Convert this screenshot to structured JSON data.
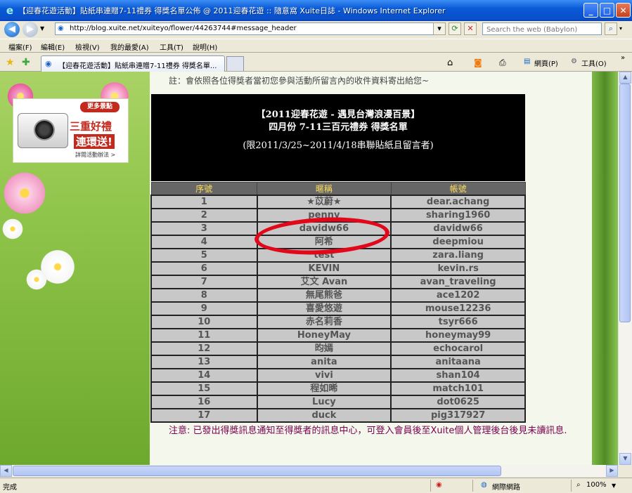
{
  "window": {
    "title": "【迎春花遊活動】貼紙串連贈7-11禮券 得獎名單公佈 @ 2011迎春花遊 :: 隨意窩 Xuite日誌 - Windows Internet Explorer",
    "min": "_",
    "max": "□",
    "close": "✕"
  },
  "address": {
    "url": "http://blog.xuite.net/xuiteyo/flower/44263744#message_header",
    "search_placeholder": "Search the web (Babylon)"
  },
  "menu": [
    "檔案(F)",
    "編輯(E)",
    "檢視(V)",
    "我的最愛(A)",
    "工具(T)",
    "說明(H)"
  ],
  "tab": {
    "label": "【迎春花遊活動】貼紙串連贈7-11禮券 得獎名單..."
  },
  "toolbar": {
    "page": "網頁(P)",
    "tools": "工具(O)",
    "more": "»"
  },
  "promo": {
    "more": "更多景點",
    "line1": "三重好禮",
    "line2": "連環送!",
    "detail": "詳閱活動辦法 >"
  },
  "content": {
    "note_top": "註：會依照各位得獎者當初您參與活動所留言內的收件資料寄出給您~",
    "header_line1": "【2011迎春花遊 - 遇見台灣浪漫百景】",
    "header_line2": "四月份 7-11三百元禮券 得獎名單",
    "header_line3": "(限2011/3/25~2011/4/18串聯貼紙且留言者)",
    "columns": [
      "序號",
      "暱稱",
      "帳號"
    ],
    "rows": [
      [
        "1",
        "★苡蔚★",
        "dear.achang"
      ],
      [
        "2",
        "penny",
        "sharing1960"
      ],
      [
        "3",
        "davidw66",
        "davidw66"
      ],
      [
        "4",
        "阿希",
        "deepmiou"
      ],
      [
        "5",
        "test",
        "zara.liang"
      ],
      [
        "6",
        "KEVIN",
        "kevin.rs"
      ],
      [
        "7",
        "艾文 Avan",
        "avan_traveling"
      ],
      [
        "8",
        "無尾熊爸",
        "ace1202"
      ],
      [
        "9",
        "喜愛悠遊",
        "mouse12236"
      ],
      [
        "10",
        "赤名莉香",
        "tsyr666"
      ],
      [
        "11",
        "HoneyMay",
        "honeymay99"
      ],
      [
        "12",
        "昀嫣",
        "echocarol"
      ],
      [
        "13",
        "anita",
        "anitaana"
      ],
      [
        "14",
        "vivi",
        "shan104"
      ],
      [
        "15",
        "程如晞",
        "match101"
      ],
      [
        "16",
        "Lucy",
        "dot0625"
      ],
      [
        "17",
        "duck",
        "pig317927"
      ]
    ],
    "note_bottom": "注意: 已發出得獎訊息通知至得獎者的訊息中心，可登入會員後至Xuite個人管理後台後見未讀訊息."
  },
  "status": {
    "text": "完成",
    "zone": "網際網路",
    "zoom": "100%"
  },
  "colors": {
    "highlight_oval": "#e0081a",
    "header_text": "#ffde5a",
    "titlebar": "#0a5ad8"
  }
}
